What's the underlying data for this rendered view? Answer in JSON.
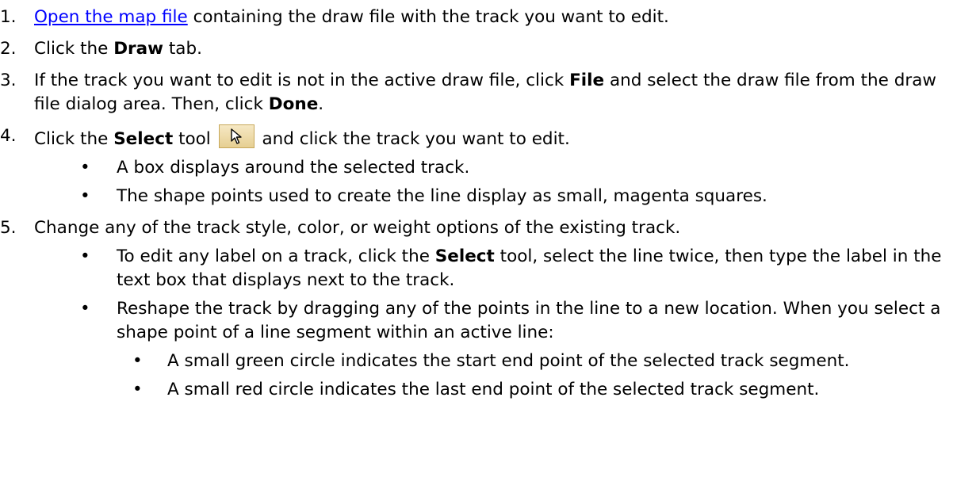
{
  "steps": [
    {
      "number": "1.",
      "link": "Open the map file",
      "text": " containing the draw file with the track you want to edit."
    },
    {
      "number": "2.",
      "pre": "Click the ",
      "bold": "Draw",
      "post": " tab."
    },
    {
      "number": "3.",
      "pre": "If the track you want to edit is not in the active draw file, click ",
      "bold1": "File",
      "mid": " and select the draw file from the draw file dialog area. Then, click ",
      "bold2": "Done",
      "post": "."
    },
    {
      "number": "4.",
      "pre": "Click the ",
      "bold": "Select",
      "mid": " tool ",
      "tool_icon": "arrow-cursor-icon",
      "post": " and click the track you want to edit.",
      "bullets": [
        "A box displays around the selected track.",
        "The shape points used to create the line display as small, magenta squares."
      ]
    },
    {
      "number": "5.",
      "text": "Change any of the track style, color, or weight options of the existing track.",
      "bullet1": {
        "pre": "To edit any label on a track, click the ",
        "bold": "Select",
        "post": " tool, select the line twice, then type the label in the text box that displays next to the track."
      },
      "bullet2": {
        "text": "Reshape the track by dragging any of the points in the line to a new location. When you select a shape point of a line segment within an active line:",
        "sub_bullets": [
          "A small green circle indicates the start end point of the selected track segment.",
          "A small red circle indicates the last end point of the selected track segment."
        ]
      }
    }
  ],
  "bullet_glyph": "•"
}
